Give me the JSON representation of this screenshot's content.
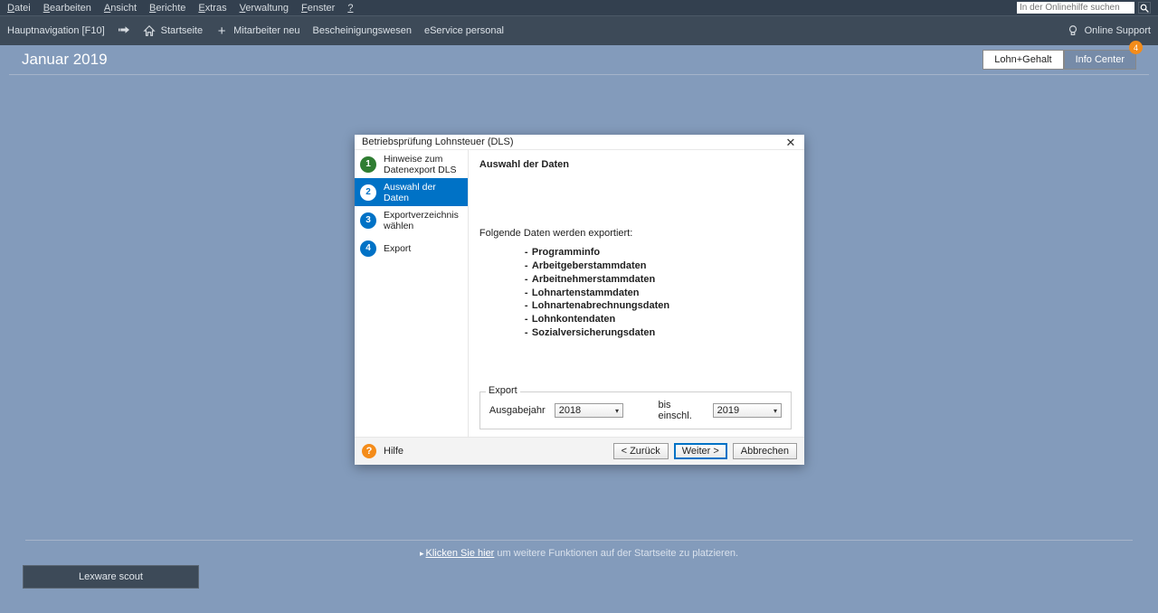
{
  "menubar": {
    "items": [
      {
        "pre": "D",
        "rest": "atei"
      },
      {
        "pre": "B",
        "rest": "earbeiten"
      },
      {
        "pre": "A",
        "rest": "nsicht"
      },
      {
        "pre": "B",
        "rest": "erichte"
      },
      {
        "pre": "E",
        "rest": "xtras"
      },
      {
        "pre": "V",
        "rest": "erwaltung"
      },
      {
        "pre": "F",
        "rest": "enster"
      },
      {
        "pre": "?",
        "rest": ""
      }
    ],
    "search_placeholder": "In der Onlinehilfe suchen"
  },
  "toolbar": {
    "main_nav": "Hauptnavigation [F10]",
    "startseite": "Startseite",
    "mitarbeiter_neu": "Mitarbeiter neu",
    "bescheinigung": "Bescheinigungswesen",
    "eservice": "eService personal",
    "online_support": "Online Support"
  },
  "subheader": {
    "title": "Januar 2019",
    "tab1": "Lohn+Gehalt",
    "tab2": "Info Center",
    "badge": "4"
  },
  "footer": {
    "link_text": "Klicken Sie hier",
    "rest": " um weitere Funktionen auf der Startseite zu platzieren."
  },
  "lex_scout": "Lexware scout",
  "dialog": {
    "title": "Betriebsprüfung Lohnsteuer (DLS)",
    "steps": [
      {
        "num": "1",
        "label": "Hinweise zum Datenexport DLS",
        "state": "done"
      },
      {
        "num": "2",
        "label": "Auswahl der Daten",
        "state": "active"
      },
      {
        "num": "3",
        "label": "Exportverzeichnis wählen",
        "state": ""
      },
      {
        "num": "4",
        "label": "Export",
        "state": ""
      }
    ],
    "content": {
      "heading": "Auswahl der Daten",
      "intro": "Folgende Daten werden exportiert:",
      "items": [
        "Programminfo",
        "Arbeitgeberstammdaten",
        "Arbeitnehmerstammdaten",
        "Lohnartenstammdaten",
        "Lohnartenabrechnungsdaten",
        "Lohnkontendaten",
        "Sozialversicherungsdaten"
      ],
      "export_legend": "Export",
      "ausgabejahr_label": "Ausgabejahr",
      "ausgabejahr_value": "2018",
      "bis_label": "bis einschl.",
      "bis_value": "2019"
    },
    "help": "Hilfe",
    "buttons": {
      "back": "< Zurück",
      "next": "Weiter >",
      "cancel": "Abbrechen"
    }
  }
}
